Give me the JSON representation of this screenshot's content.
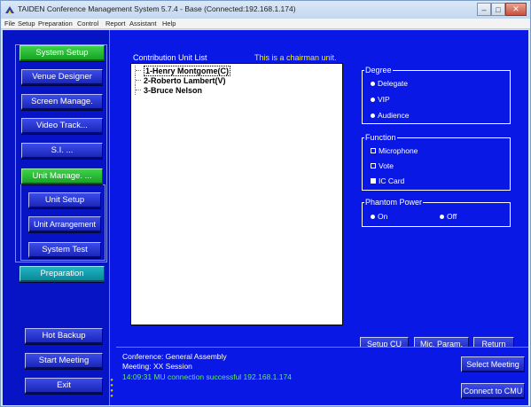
{
  "window": {
    "title": "TAIDEN Conference Management System 5.7.4 - Base (Connected:192.168.1.174)",
    "controls": {
      "minimize": "–",
      "maximize": "□",
      "close": "✕"
    }
  },
  "menu": [
    "File",
    "Setup",
    "Preparation",
    "Control",
    "Report",
    "Assistant",
    "Help"
  ],
  "sidebar": {
    "system_setup": "System Setup",
    "venue_designer": "Venue Designer",
    "screen_manage": "Screen Manage.",
    "video_track": "Video Track...",
    "si": "S.I. ...",
    "unit_manage": "Unit Manage. ...",
    "unit_setup": "Unit Setup",
    "unit_arrangement": "Unit Arrangement",
    "system_test": "System Test",
    "preparation": "Preparation",
    "hot_backup": "Hot Backup",
    "start_meeting": "Start Meeting",
    "exit": "Exit"
  },
  "main": {
    "list_label": "Contribution Unit List",
    "chairman_note": "This is a chairman unit.",
    "units": [
      "1-Henry Montgome(C)",
      "2-Roberto Lambert(V)",
      "3-Bruce Nelson"
    ],
    "selected_unit": 0,
    "degree": {
      "label": "Degree",
      "options": [
        "Delegate",
        "VIP",
        "Audience"
      ]
    },
    "function": {
      "label": "Function",
      "options": [
        {
          "label": "Microphone",
          "checked": true
        },
        {
          "label": "Vote",
          "checked": true
        },
        {
          "label": "IC Card",
          "checked": false
        }
      ]
    },
    "phantom_power": {
      "label": "Phantom Power",
      "on": "On",
      "off": "Off"
    },
    "buttons": {
      "setup_cu": "Setup CU",
      "mic_param": "Mic. Param.",
      "return": "Return"
    }
  },
  "status": {
    "conference": "Conference: General Assembly",
    "meeting": "Meeting: XX Session",
    "log": "14:09:31 MU connection successful 192.168.1.174",
    "select_meeting": "Select Meeting",
    "connect_cmu": "Connect to CMU"
  },
  "colors": {
    "background": "#0a18e6",
    "active_button": "#18a326",
    "preparation_button": "#0a8a99",
    "note_text": "#f7f000",
    "log_text": "#5ee86a"
  }
}
